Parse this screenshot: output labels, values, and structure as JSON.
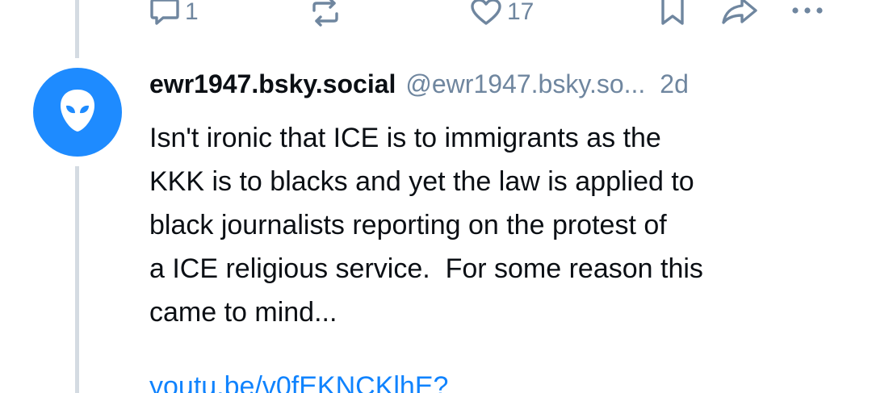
{
  "previous_post": {
    "actions": {
      "reply_count": "1",
      "repost_count": "",
      "like_count": "17"
    },
    "icons": {
      "reply": "reply-bubble-icon",
      "repost": "repost-arrows-icon",
      "like": "heart-icon",
      "bookmark": "bookmark-icon",
      "share": "share-arrow-icon",
      "more": "more-dots-icon"
    }
  },
  "post": {
    "avatar_icon": "alien-face-icon",
    "display_name": "ewr1947.bsky.social",
    "handle": "@ewr1947.bsky.so...",
    "timestamp": "2d",
    "text": "Isn't ironic that ICE is to immigrants as the\nKKK is to blacks and yet the law is applied to\nblack journalists reporting on the protest of\na ICE religious service.  For some reason this\ncame to mind...",
    "link": "youtu.be/v0fEKNCKlhE?"
  },
  "colors": {
    "accent": "#1083fe",
    "avatar_bg": "#1e8bff",
    "muted": "#6f869f",
    "text": "#0b0f14",
    "thread_line": "#d4dbe2"
  }
}
